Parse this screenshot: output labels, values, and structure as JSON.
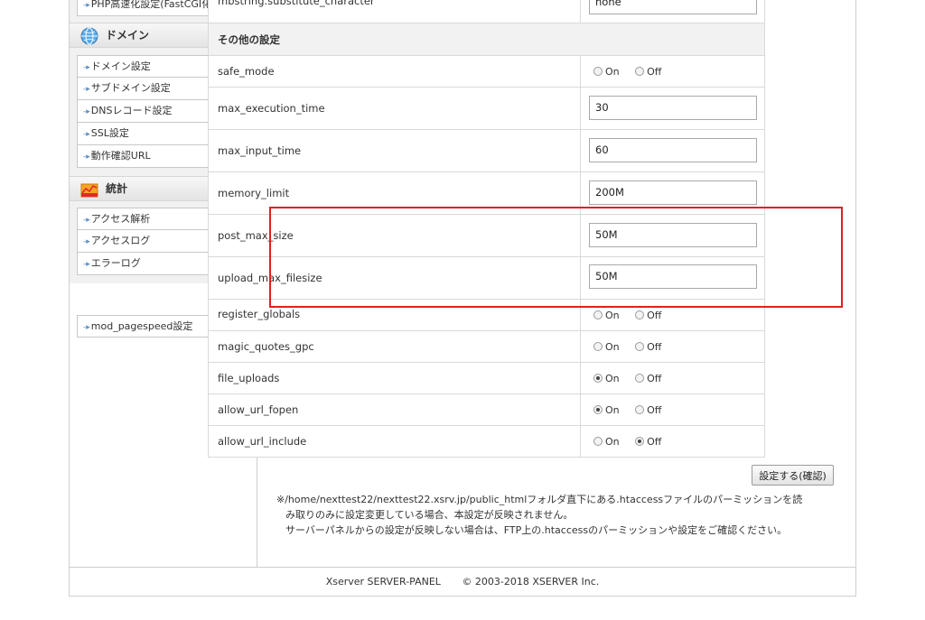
{
  "sidebar": {
    "top_item": "PHP高速化設定(FastCGI化)",
    "domain_section": {
      "title": "ドメイン",
      "items": [
        "ドメイン設定",
        "サブドメイン設定",
        "DNSレコード設定",
        "SSL設定",
        "動作確認URL"
      ]
    },
    "stats_section": {
      "title": "統計",
      "items": [
        "アクセス解析",
        "アクセスログ",
        "エラーログ"
      ]
    },
    "extra_item": "mod_pagespeed設定"
  },
  "settings": {
    "top_row": {
      "label": "mbstring.substitute_character",
      "value": "none"
    },
    "group_title": "その他の設定",
    "on_label": "On",
    "off_label": "Off",
    "rows": {
      "safe_mode": {
        "label": "safe_mode",
        "selected": "none"
      },
      "max_execution_time": {
        "label": "max_execution_time",
        "value": "30"
      },
      "max_input_time": {
        "label": "max_input_time",
        "value": "60"
      },
      "memory_limit": {
        "label": "memory_limit",
        "value": "200M"
      },
      "post_max_size": {
        "label": "post_max_size",
        "value": "50M"
      },
      "upload_max_filesize": {
        "label": "upload_max_filesize",
        "value": "50M"
      },
      "register_globals": {
        "label": "register_globals",
        "selected": "none"
      },
      "magic_quotes_gpc": {
        "label": "magic_quotes_gpc",
        "selected": "none"
      },
      "file_uploads": {
        "label": "file_uploads",
        "selected": "on"
      },
      "allow_url_fopen": {
        "label": "allow_url_fopen",
        "selected": "on"
      },
      "allow_url_include": {
        "label": "allow_url_include",
        "selected": "off"
      }
    },
    "submit_label": "設定する(確認)"
  },
  "note": {
    "line1": "※/home/nexttest22/nexttest22.xsrv.jp/public_htmlフォルダ直下にある.htaccessファイルのパーミッションを読",
    "line2": "み取りのみに設定変更している場合、本設定が反映されません。",
    "line3": "サーバーパネルからの設定が反映しない場合は、FTP上の.htaccessのパーミッションや設定をご確認ください。"
  },
  "footer": {
    "product": "Xserver SERVER-PANEL",
    "copyright": "© 2003-2018 XSERVER Inc."
  },
  "colors": {
    "highlight": "#e02020",
    "arrow": "#5a8fc6"
  }
}
